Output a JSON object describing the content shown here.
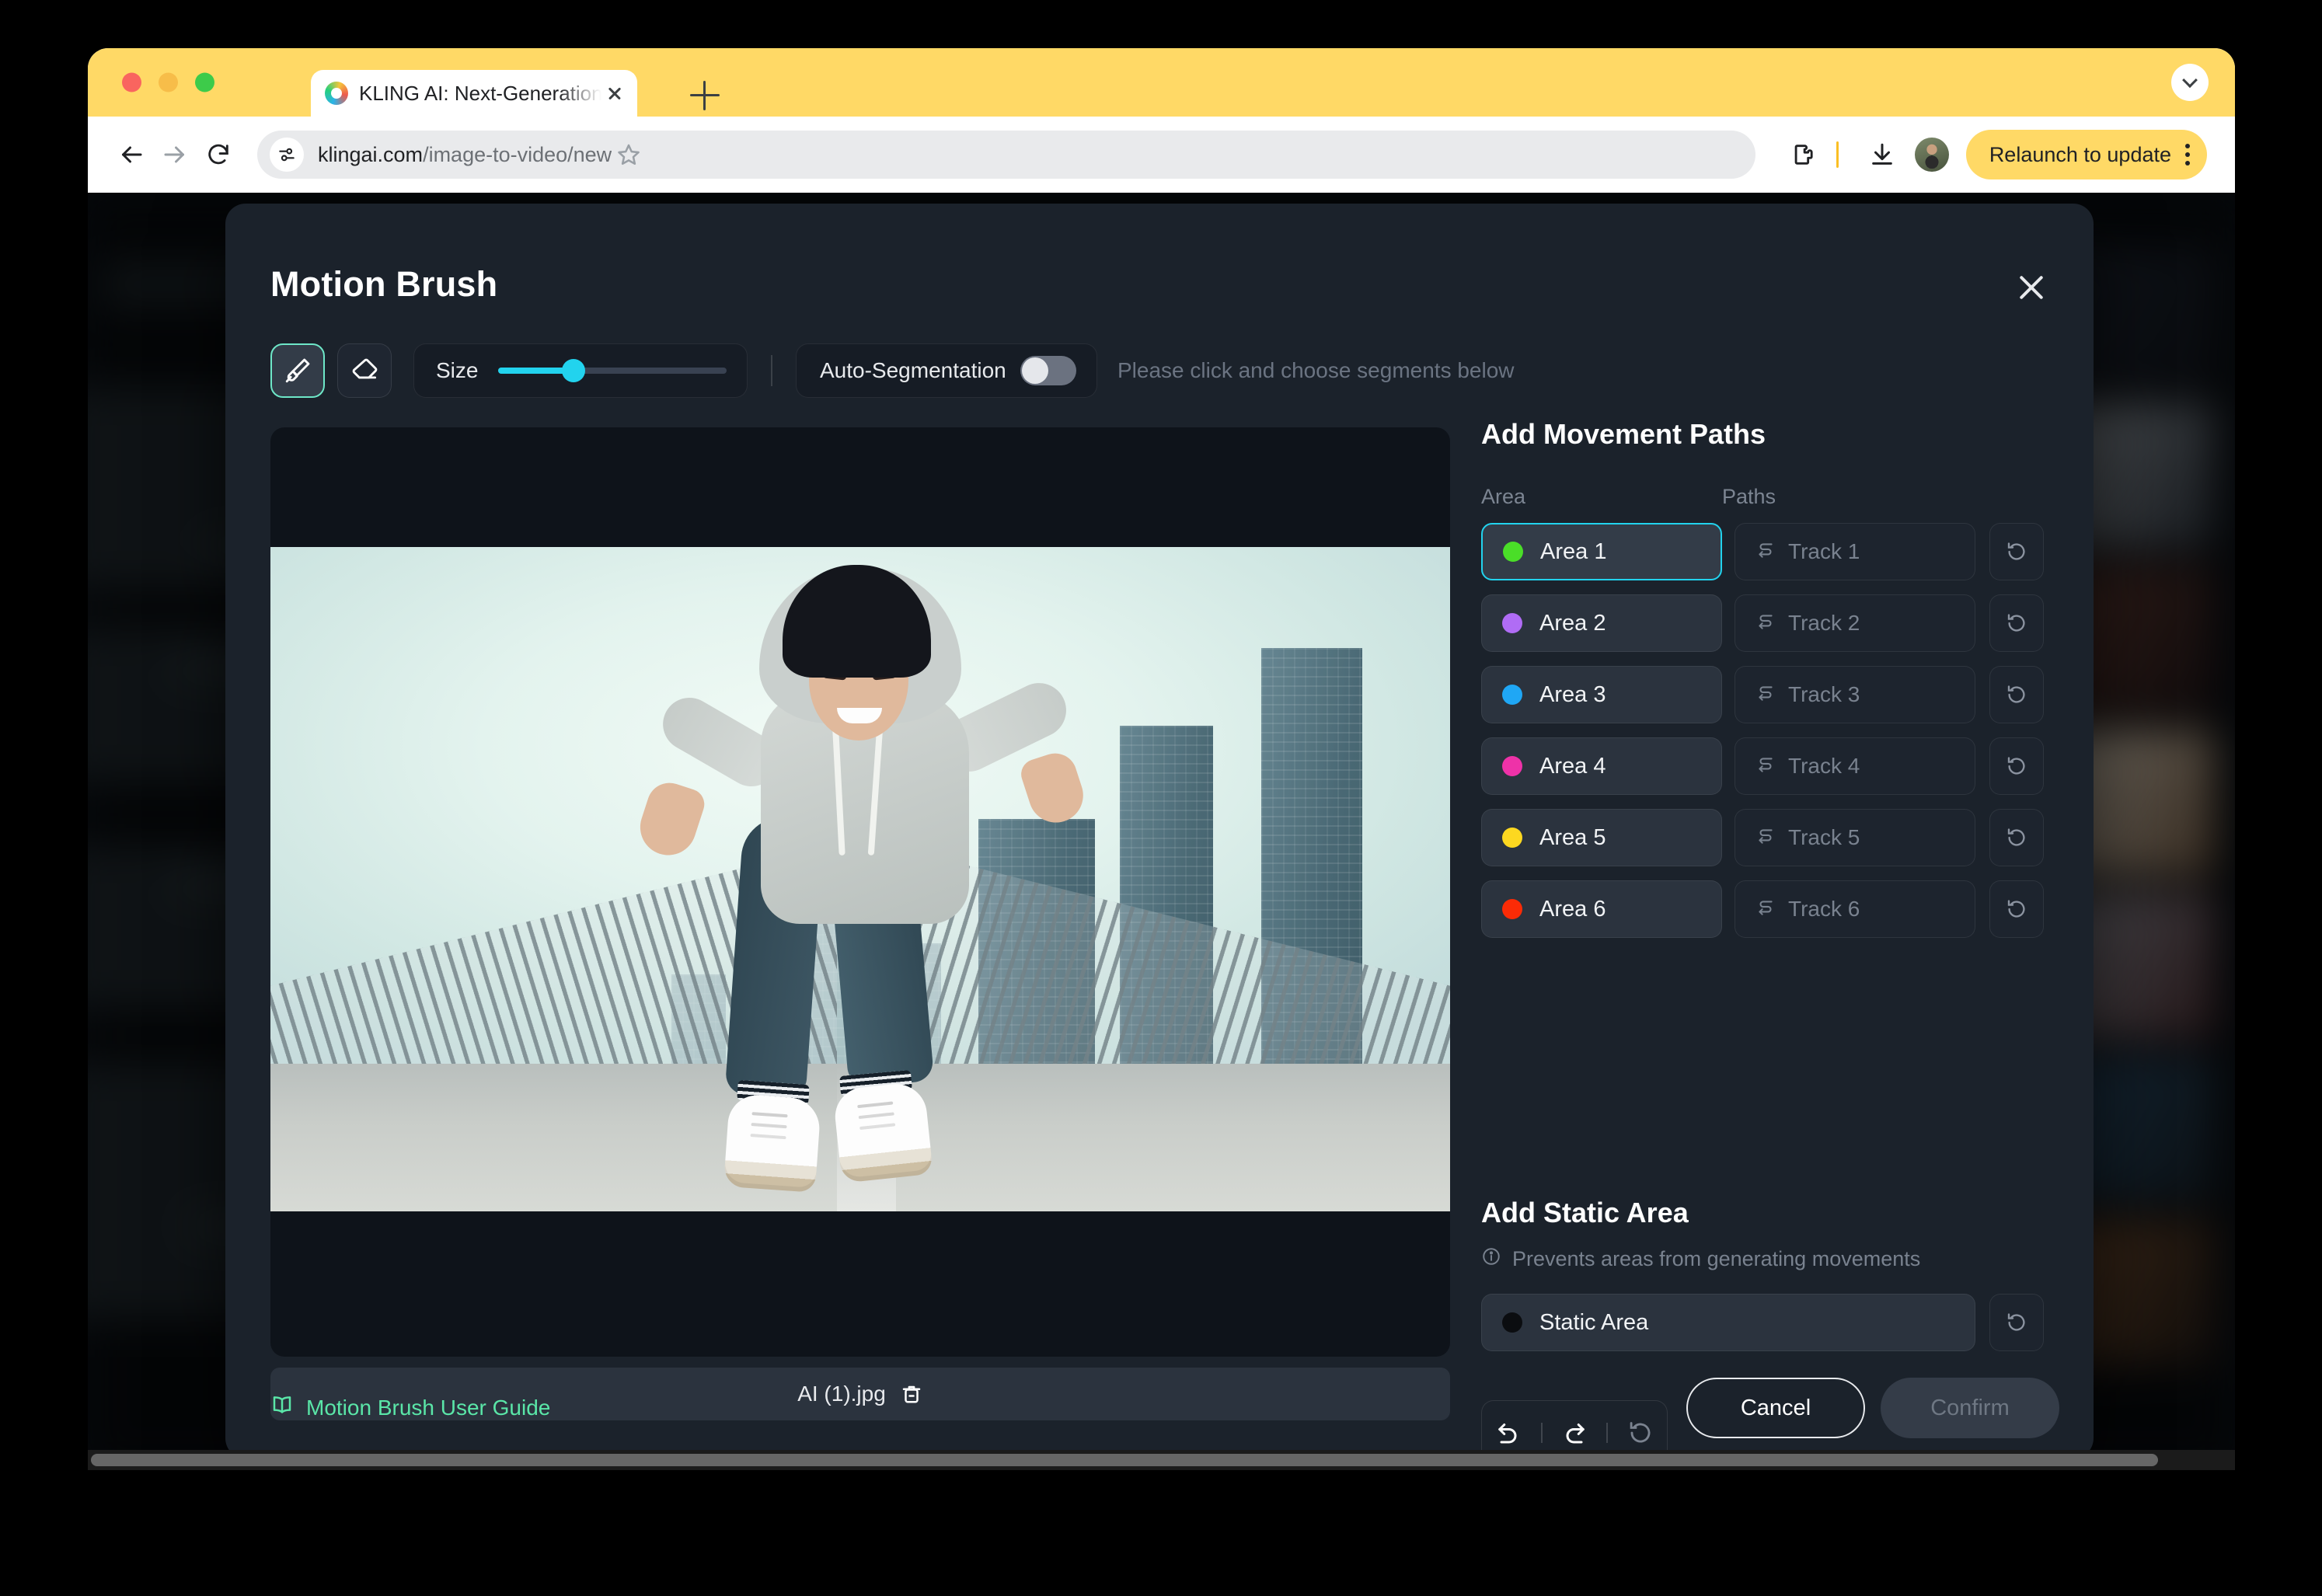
{
  "browser": {
    "tab": {
      "title": "KLING AI: Next-Generation AI",
      "favicon": "kling-logo-icon"
    },
    "new_tab_label": "+",
    "url_prefix": "klingai.com",
    "url_path": "/image-to-video/new",
    "relaunch_label": "Relaunch to update",
    "icons": {
      "back": "back-arrow-icon",
      "forward": "forward-arrow-icon",
      "reload": "reload-icon",
      "site_info": "site-settings-icon",
      "bookmark": "star-icon",
      "extensions": "extensions-puzzle-icon",
      "downloads": "download-icon",
      "profile": "avatar-icon",
      "kebab": "more-vertical-icon",
      "tabstrip_chevron": "chevron-down-icon",
      "tab_close": "close-icon"
    }
  },
  "modal": {
    "title": "Motion Brush",
    "close_icon": "close-icon",
    "toolbar": {
      "brush_tool": {
        "name": "brush-icon",
        "active": true
      },
      "eraser_tool": {
        "name": "eraser-icon",
        "active": false
      },
      "size_label": "Size",
      "size_percent": 33,
      "autoseg_label": "Auto-Segmentation",
      "autoseg_enabled": false,
      "autoseg_hint": "Please click and choose segments below"
    },
    "image": {
      "filename": "AI (1).jpg",
      "delete_icon": "trash-icon",
      "description": "Man in gray hoodie jumping in mid-air on a pedestrian bridge with city skyline"
    },
    "paths_section": {
      "title": "Add Movement Paths",
      "col_area": "Area",
      "col_paths": "Paths",
      "track_icon": "track-path-icon",
      "reset_icon": "reset-icon",
      "rows": [
        {
          "area_label": "Area 1",
          "color": "#4ade28",
          "track_placeholder": "Track 1",
          "selected": true
        },
        {
          "area_label": "Area 2",
          "color": "#b06cf5",
          "track_placeholder": "Track 2",
          "selected": false
        },
        {
          "area_label": "Area 3",
          "color": "#1fa7f5",
          "track_placeholder": "Track 3",
          "selected": false
        },
        {
          "area_label": "Area 4",
          "color": "#ee32a8",
          "track_placeholder": "Track 4",
          "selected": false
        },
        {
          "area_label": "Area 5",
          "color": "#fdd820",
          "track_placeholder": "Track 5",
          "selected": false
        },
        {
          "area_label": "Area 6",
          "color": "#fb2b06",
          "track_placeholder": "Track 6",
          "selected": false
        }
      ]
    },
    "static_section": {
      "title": "Add Static Area",
      "hint": "Prevents areas from generating movements",
      "hint_icon": "info-icon",
      "label": "Static Area",
      "color": "#0b0d10",
      "reset_icon": "reset-icon"
    },
    "history": {
      "undo_icon": "undo-icon",
      "redo_icon": "redo-icon",
      "reset_icon": "reset-icon"
    },
    "footer": {
      "guide_label": "Motion Brush User Guide",
      "guide_icon": "book-icon",
      "cancel_label": "Cancel",
      "confirm_label": "Confirm",
      "confirm_disabled": true
    }
  },
  "colors": {
    "accent_cyan": "#22d3ee",
    "accent_mint": "#6ee7c8",
    "guide_green": "#5ae6a8",
    "modal_bg": "#1b222b",
    "browser_accent": "#ffd966"
  }
}
